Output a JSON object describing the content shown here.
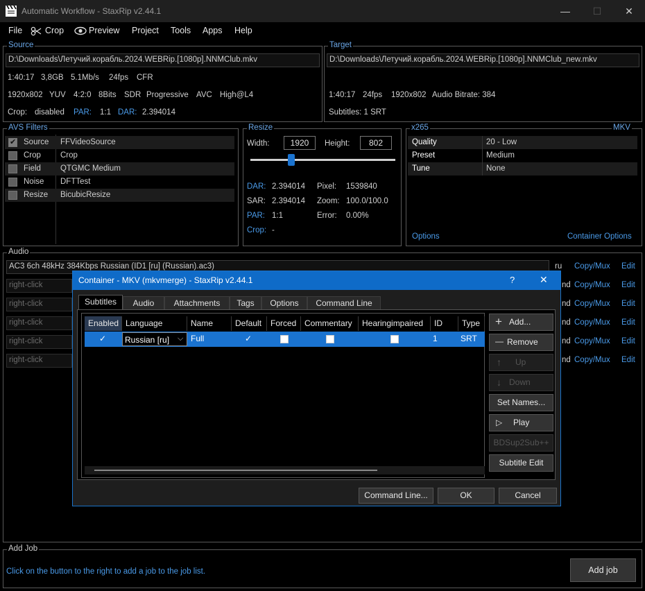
{
  "window": {
    "title": "Automatic Workflow - StaxRip v2.44.1",
    "minimize": "—",
    "maximize": "☐",
    "close": "✕"
  },
  "menu": {
    "file": "File",
    "crop": "Crop",
    "preview": "Preview",
    "project": "Project",
    "tools": "Tools",
    "apps": "Apps",
    "help": "Help"
  },
  "source": {
    "label": "Source",
    "path": "D:\\Downloads\\Летучий.корабль.2024.WEBRip.[1080p].NNMClub.mkv",
    "line1": [
      "1:40:17",
      "3,8GB",
      "5.1Mb/s",
      "24fps",
      "CFR"
    ],
    "line2": [
      "1920x802",
      "YUV",
      "4:2:0",
      "8Bits",
      "SDR",
      "Progressive",
      "AVC",
      "High@L4"
    ],
    "crop_label": "Crop:",
    "crop_value": "disabled",
    "par_label": "PAR:",
    "par_value": "1:1",
    "dar_label": "DAR:",
    "dar_value": "2.394014"
  },
  "target": {
    "label": "Target",
    "path": "D:\\Downloads\\Летучий.корабль.2024.WEBRip.[1080p].NNMClub_new.mkv",
    "line1": [
      "1:40:17",
      "24fps",
      "1920x802",
      "Audio Bitrate: 384"
    ],
    "subtitles": "Subtitles: 1 SRT"
  },
  "avs": {
    "label": "AVS Filters",
    "rows": [
      {
        "name": "Source",
        "value": "FFVideoSource",
        "checked": true
      },
      {
        "name": "Crop",
        "value": "Crop",
        "checked": false
      },
      {
        "name": "Field",
        "value": "QTGMC Medium",
        "checked": false
      },
      {
        "name": "Noise",
        "value": "DFTTest",
        "checked": false
      },
      {
        "name": "Resize",
        "value": "BicubicResize",
        "checked": false
      }
    ]
  },
  "resize": {
    "label": "Resize",
    "width_label": "Width:",
    "width": "1920",
    "height_label": "Height:",
    "height": "802",
    "slider_level": 0.27,
    "dar_label": "DAR:",
    "dar": "2.394014",
    "pixel_label": "Pixel:",
    "pixel": "1539840",
    "sar_label": "SAR:",
    "sar": "2.394014",
    "zoom_label": "Zoom:",
    "zoom": "100.0/100.0",
    "par_label": "PAR:",
    "par": "1:1",
    "error_label": "Error:",
    "error": "0.00%",
    "crop_label": "Crop:",
    "crop": "-"
  },
  "encoder": {
    "label": "x265",
    "container_label": "MKV",
    "rows": [
      {
        "name": "Quality",
        "value": "20 - Low"
      },
      {
        "name": "Preset",
        "value": "Medium"
      },
      {
        "name": "Tune",
        "value": "None"
      }
    ],
    "options": "Options",
    "container_options": "Container Options"
  },
  "audio": {
    "label": "Audio",
    "first_track": "AC3 6ch 48kHz 384Kbps Russian (ID1 [ru] (Russian).ac3)",
    "first_lang": "ru",
    "placeholder": "right-click",
    "hidden_lang": "nd",
    "copy_mux": "Copy/Mux",
    "edit": "Edit"
  },
  "addjob": {
    "label": "Add Job",
    "hint": "Click on the button to the right to add a job to the job list.",
    "button": "Add job"
  },
  "dialog": {
    "title": "Container - MKV (mkvmerge) - StaxRip v2.44.1",
    "help": "?",
    "close": "✕",
    "tabs": [
      "Subtitles",
      "Audio",
      "Attachments",
      "Tags",
      "Options",
      "Command Line"
    ],
    "columns": [
      "Enabled",
      "Language",
      "Name",
      "Default",
      "Forced",
      "Commentary",
      "Hearingimpaired",
      "ID",
      "Type"
    ],
    "row": {
      "language": "Russian [ru]",
      "name": "Full",
      "id": "1",
      "type": "SRT"
    },
    "side_buttons": {
      "add": "Add...",
      "remove": "Remove",
      "up": "Up",
      "down": "Down",
      "set_names": "Set Names...",
      "play": "Play",
      "bdsup": "BDSup2Sub++",
      "subtitle_edit": "Subtitle Edit"
    },
    "command_line": "Command Line...",
    "ok": "OK",
    "cancel": "Cancel"
  }
}
